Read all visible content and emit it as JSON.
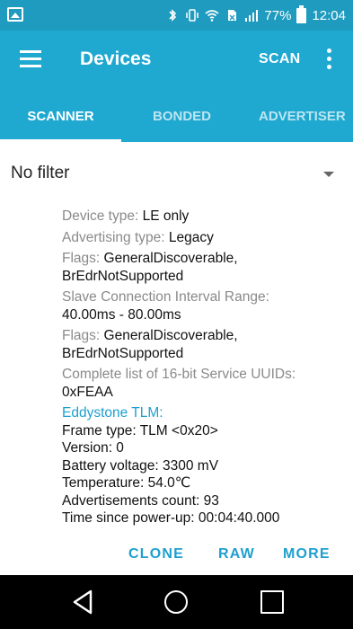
{
  "status_bar": {
    "battery": "77%",
    "time": "12:04"
  },
  "app_bar": {
    "title": "Devices",
    "scan_label": "SCAN"
  },
  "tabs": [
    {
      "label": "SCANNER",
      "active": true
    },
    {
      "label": "BONDED",
      "active": false
    },
    {
      "label": "ADVERTISER",
      "active": false
    }
  ],
  "filter": {
    "label": "No filter"
  },
  "details": {
    "device_type_label": "Device type:",
    "device_type_value": "LE only",
    "adv_type_label": "Advertising type:",
    "adv_type_value": "Legacy",
    "flags1_label": "Flags:",
    "flags1_value_a": "GeneralDiscoverable,",
    "flags1_value_b": "BrEdrNotSupported",
    "slave_label": "Slave Connection Interval Range:",
    "slave_value": "40.00ms - 80.00ms",
    "flags2_label": "Flags:",
    "flags2_value_a": "GeneralDiscoverable,",
    "flags2_value_b": "BrEdrNotSupported",
    "uuids_label": "Complete list of 16-bit Service UUIDs:",
    "uuids_value": "0xFEAA",
    "eddystone_label": "Eddystone TLM:",
    "frame_type": "Frame type: TLM <0x20>",
    "version": "Version: 0",
    "battery_voltage": "Battery voltage: 3300 mV",
    "temperature": "Temperature: 54.0℃",
    "adv_count": "Advertisements count: 93",
    "time_since": "Time since power-up: 00:04:40.000"
  },
  "actions": {
    "clone": "CLONE",
    "raw": "RAW",
    "more": "MORE"
  },
  "colors": {
    "status_bar": "#1e9bbf",
    "primary": "#1fa8d0",
    "accent": "#1e9fd0"
  }
}
